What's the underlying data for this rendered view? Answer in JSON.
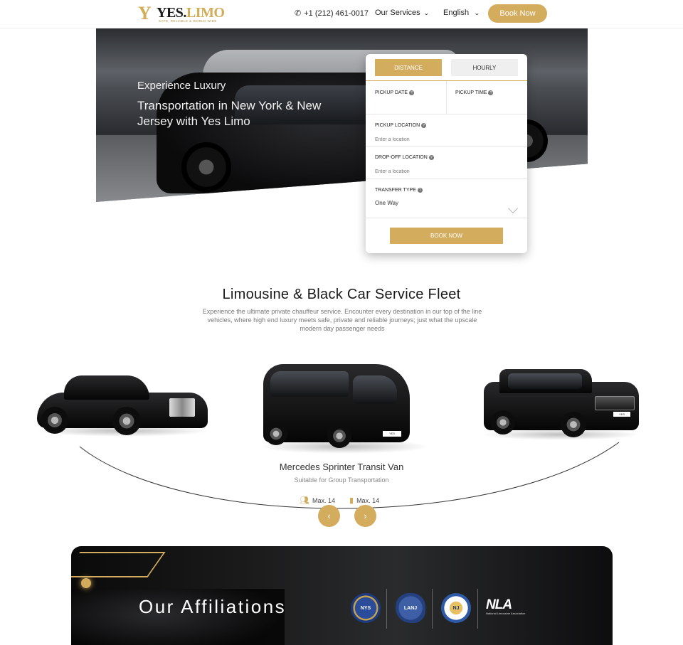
{
  "header": {
    "logo_y": "Y",
    "logo_text_1": "YES.",
    "logo_text_2": "LIMO",
    "logo_tagline": "SAFE, RELIABLE & WORLD WIDE",
    "phone": "+1 (212) 461-0017",
    "services_label": "Our Services",
    "language_label": "English",
    "book_button": "Book Now"
  },
  "hero": {
    "title_line1": "Experience Luxury",
    "title_line2": "Transportation in New York & New Jersey with Yes Limo"
  },
  "booking": {
    "tab_distance": "DISTANCE",
    "tab_hourly": "HOURLY",
    "pickup_date_label": "PICKUP DATE",
    "pickup_time_label": "PICKUP TIME",
    "pickup_location_label": "PICKUP LOCATION",
    "pickup_location_placeholder": "Enter a location",
    "dropoff_location_label": "DROP-OFF LOCATION",
    "dropoff_location_placeholder": "Enter a location",
    "transfer_type_label": "TRANSFER TYPE",
    "transfer_type_value": "One Way",
    "book_button": "BOOK NOW",
    "help_icon": "?"
  },
  "fleet": {
    "title": "Limousine & Black Car Service Fleet",
    "description": "Experience the ultimate private chauffeur service. Encounter every destination in our top of the line vehicles, where high end luxury meets safe, private and reliable journeys; just what the upscale modern day passenger needs",
    "vehicle_name": "Mercedes Sprinter Transit Van",
    "vehicle_subtitle": "Suitable for Group Transportation",
    "passengers": "Max. 14",
    "luggage": "Max. 14",
    "prev_icon": "‹",
    "next_icon": "›",
    "plate_text": "YES"
  },
  "affiliations": {
    "title": "Our Affiliations",
    "seal1_text": "NYS",
    "seal2_text": "LANJ",
    "seal3_text": "NJ",
    "nla_main": "NLA",
    "nla_sub": "National Limousine Association"
  },
  "colors": {
    "accent": "#d3ac5e",
    "dark": "#1a1a1a"
  }
}
